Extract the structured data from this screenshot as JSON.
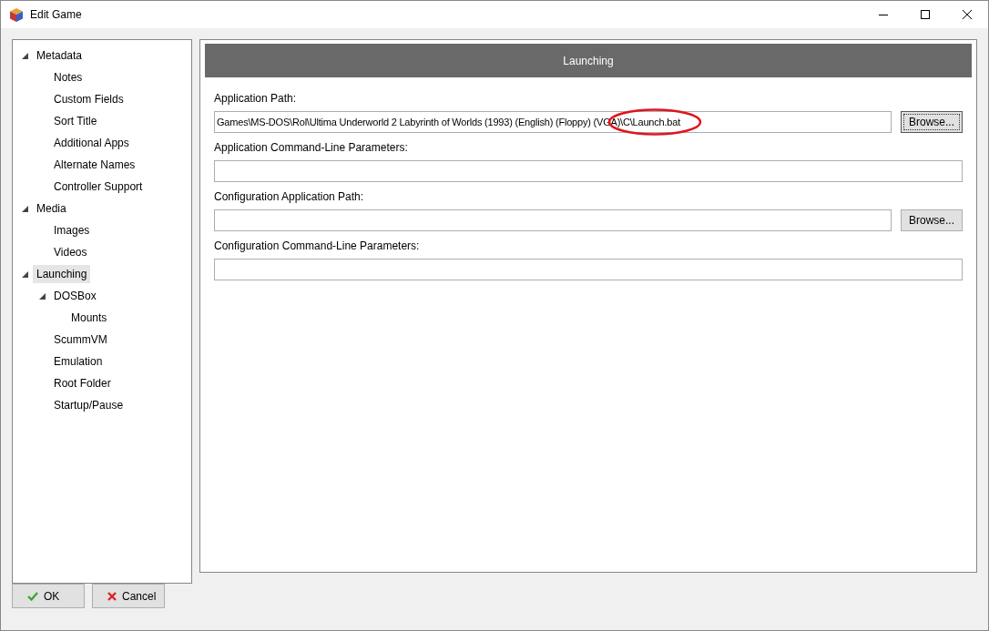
{
  "window": {
    "title": "Edit Game"
  },
  "tree": [
    {
      "label": "Metadata",
      "expanded": true,
      "selected": false,
      "children": [
        {
          "label": "Notes",
          "selected": false
        },
        {
          "label": "Custom Fields",
          "selected": false
        },
        {
          "label": "Sort Title",
          "selected": false
        },
        {
          "label": "Additional Apps",
          "selected": false
        },
        {
          "label": "Alternate Names",
          "selected": false
        },
        {
          "label": "Controller Support",
          "selected": false
        }
      ]
    },
    {
      "label": "Media",
      "expanded": true,
      "selected": false,
      "children": [
        {
          "label": "Images",
          "selected": false
        },
        {
          "label": "Videos",
          "selected": false
        }
      ]
    },
    {
      "label": "Launching",
      "expanded": true,
      "selected": true,
      "children": [
        {
          "label": "DOSBox",
          "expanded": true,
          "selected": false,
          "children": [
            {
              "label": "Mounts",
              "selected": false
            }
          ]
        },
        {
          "label": "ScummVM",
          "selected": false
        },
        {
          "label": "Emulation",
          "selected": false
        },
        {
          "label": "Root Folder",
          "selected": false
        },
        {
          "label": "Startup/Pause",
          "selected": false
        }
      ]
    }
  ],
  "panel": {
    "header": "Launching",
    "fields": [
      {
        "label": "Application Path:",
        "value": "Games\\MS-DOS\\Rol\\Ultima Underworld 2 Labyrinth of Worlds (1993) (English) (Floppy) (VGA)\\C\\Launch.bat",
        "circled": true,
        "browse": "Browse...",
        "browse_focused": true
      },
      {
        "label": "Application Command-Line Parameters:"
      },
      {
        "label": "Configuration Application Path:",
        "browse": "Browse...",
        "browse_focused": false
      },
      {
        "label": "Configuration Command-Line Parameters:"
      }
    ]
  },
  "buttons": [
    {
      "kind": "ok",
      "label": "OK"
    },
    {
      "kind": "cancel",
      "label": "Cancel"
    }
  ]
}
